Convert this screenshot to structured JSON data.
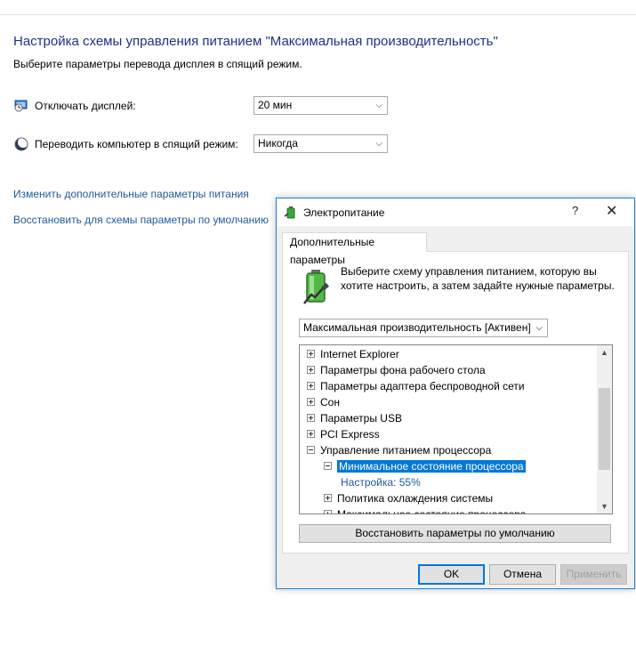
{
  "main": {
    "title": "Настройка схемы управления питанием \"Максимальная производительность\"",
    "subtitle": "Выберите параметры перевода дисплея в спящий режим.",
    "display_off": {
      "label": "Отключать дисплей:",
      "value": "20 мин"
    },
    "sleep": {
      "label": "Переводить компьютер в спящий режим:",
      "value": "Никогда"
    },
    "links": {
      "advanced": "Изменить дополнительные параметры питания",
      "restore": "Восстановить для схемы параметры по умолчанию"
    }
  },
  "dialog": {
    "title": "Электропитание",
    "help": "?",
    "close": "✕",
    "tab": "Дополнительные параметры",
    "description": "Выберите схему управления питанием, которую вы хотите настроить, а затем задайте нужные параметры.",
    "scheme": "Максимальная производительность [Активен]",
    "tree": [
      {
        "label": "Internet Explorer",
        "indent": 0,
        "state": "plus"
      },
      {
        "label": "Параметры фона рабочего стола",
        "indent": 0,
        "state": "plus"
      },
      {
        "label": "Параметры адаптера беспроводной сети",
        "indent": 0,
        "state": "plus"
      },
      {
        "label": "Сон",
        "indent": 0,
        "state": "plus"
      },
      {
        "label": "Параметры USB",
        "indent": 0,
        "state": "plus"
      },
      {
        "label": "PCI Express",
        "indent": 0,
        "state": "plus"
      },
      {
        "label": "Управление питанием процессора",
        "indent": 0,
        "state": "minus"
      },
      {
        "label": "Минимальное состояние процессора",
        "indent": 1,
        "state": "minus",
        "selected": true
      },
      {
        "label": "Настройка: 55%",
        "indent": 2,
        "state": "none",
        "setting": true
      },
      {
        "label": "Политика охлаждения системы",
        "indent": 1,
        "state": "plus"
      },
      {
        "label": "Максимальное состояние процессора",
        "indent": 1,
        "state": "plus"
      }
    ],
    "restore_button": "Восстановить параметры по умолчанию",
    "buttons": {
      "ok": "OK",
      "cancel": "Отмена",
      "apply": "Применить"
    }
  },
  "colors": {
    "accent": "#0078d7",
    "link": "#1e5a9c",
    "title": "#1e3287"
  }
}
